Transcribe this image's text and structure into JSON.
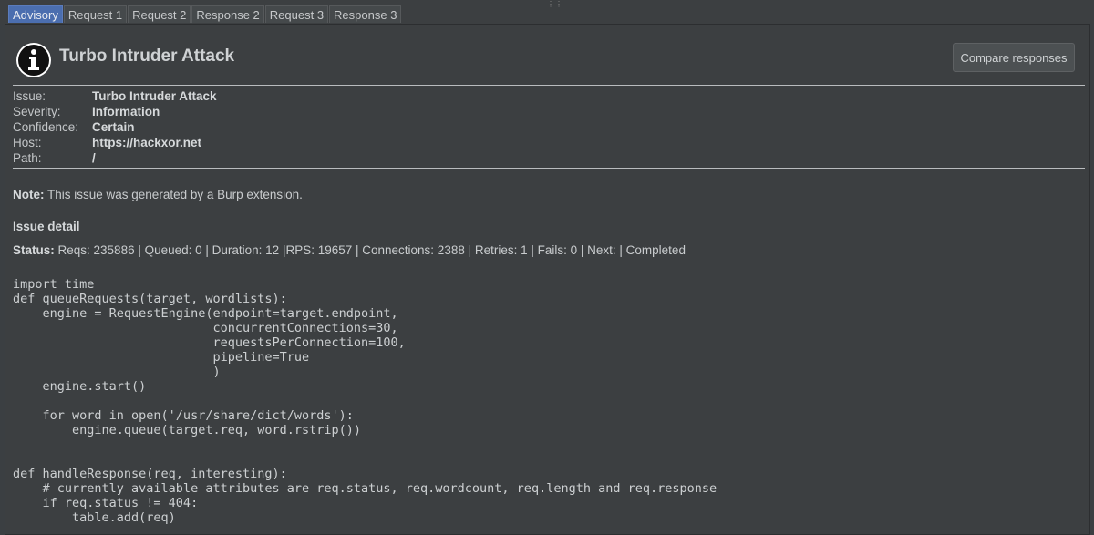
{
  "tabs": [
    {
      "label": "Advisory",
      "active": true
    },
    {
      "label": "Request 1",
      "active": false
    },
    {
      "label": "Request 2",
      "active": false
    },
    {
      "label": "Response 2",
      "active": false
    },
    {
      "label": "Request 3",
      "active": false
    },
    {
      "label": "Response 3",
      "active": false
    }
  ],
  "header": {
    "title": "Turbo Intruder Attack",
    "compare_label": "Compare responses",
    "icon": "info-icon"
  },
  "meta": [
    {
      "label": "Issue:",
      "value": "Turbo Intruder Attack"
    },
    {
      "label": "Severity:",
      "value": "Information"
    },
    {
      "label": "Confidence:",
      "value": "Certain"
    },
    {
      "label": "Host:",
      "value": "https://hackxor.net"
    },
    {
      "label": "Path:",
      "value": "/"
    }
  ],
  "note": {
    "label": "Note:",
    "text": " This issue was generated by a Burp extension."
  },
  "issue_detail": {
    "heading": "Issue detail",
    "status_label": "Status:",
    "status_text": " Reqs: 235886 | Queued: 0 | Duration: 12 |RPS: 19657 | Connections: 2388 | Retries: 1 | Fails: 0 | Next: | Completed",
    "code": "import time\ndef queueRequests(target, wordlists):\n    engine = RequestEngine(endpoint=target.endpoint,\n                           concurrentConnections=30,\n                           requestsPerConnection=100,\n                           pipeline=True\n                           )\n    engine.start()\n\n    for word in open('/usr/share/dict/words'):\n        engine.queue(target.req, word.rstrip())\n\n\ndef handleResponse(req, interesting):\n    # currently available attributes are req.status, req.wordcount, req.length and req.response\n    if req.status != 404:\n        table.add(req)"
  }
}
